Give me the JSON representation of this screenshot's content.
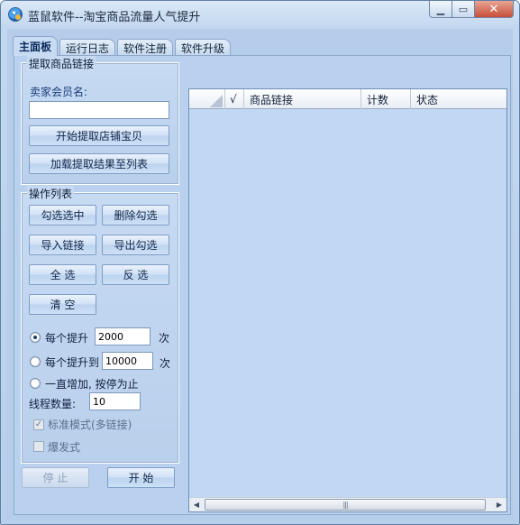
{
  "window": {
    "title": "蓝鼠软件--淘宝商品流量人气提升",
    "min_icon": "minimize-icon",
    "max_icon": "maximize-icon",
    "close_icon": "close-icon",
    "close_glyph": "✕",
    "min_glyph": "▁",
    "max_glyph": "▭"
  },
  "tabs": [
    {
      "label": "主面板",
      "active": true
    },
    {
      "label": "运行日志",
      "active": false
    },
    {
      "label": "软件注册",
      "active": false
    },
    {
      "label": "软件升级",
      "active": false
    }
  ],
  "extract": {
    "group_title": "提取商品链接",
    "seller_label": "卖家会员名:",
    "seller_value": "",
    "start_button": "开始提取店铺宝贝",
    "load_button": "加载提取结果至列表"
  },
  "ops": {
    "group_title": "操作列表",
    "check_selected": "勾选选中",
    "delete_checked": "删除勾选",
    "import_links": "导入链接",
    "export_checked": "导出勾选",
    "select_all": "全 选",
    "invert": "反 选",
    "clear": "清 空",
    "mode_each": {
      "label": "每个提升",
      "value": "2000",
      "unit": "次",
      "selected": true
    },
    "mode_to": {
      "label": "每个提升到",
      "value": "10000",
      "unit": "次",
      "selected": false
    },
    "mode_forever": {
      "label": "一直增加, 按停为止",
      "selected": false
    },
    "threads_label": "线程数量:",
    "threads_value": "10",
    "standard_mode": {
      "label": "标准模式(多链接)",
      "checked": true
    },
    "burst_mode": {
      "label": "爆发式",
      "checked": false
    }
  },
  "actions": {
    "stop": "停 止",
    "start": "开 始"
  },
  "table": {
    "check_col": "√",
    "columns": [
      "商品链接",
      "计数",
      "状态"
    ],
    "rows": [],
    "scroll_left": "◀",
    "scroll_right": "▶",
    "scroll_grip": "|||"
  },
  "colors": {
    "accent": "#1b3d7a",
    "window_bg": "#b5ccea",
    "grid_bg": "#c1d8f5"
  }
}
